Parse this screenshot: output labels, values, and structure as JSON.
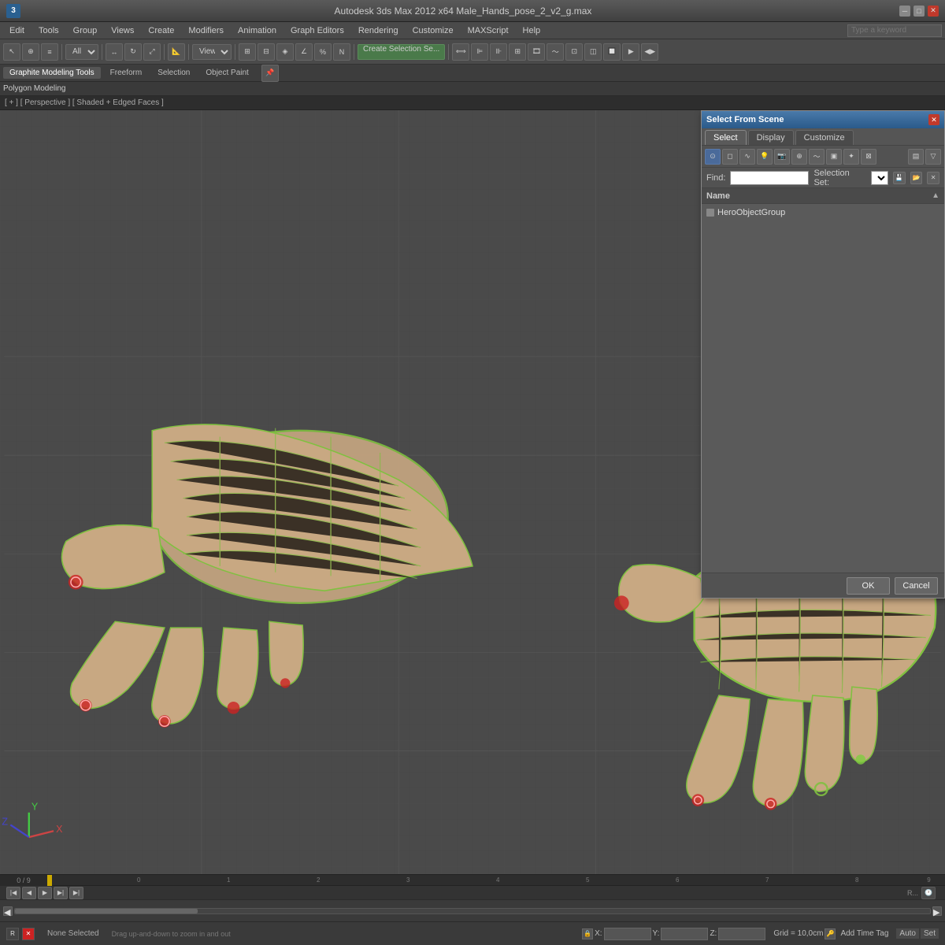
{
  "titlebar": {
    "app_icon": "3",
    "title": "Autodesk 3ds Max 2012 x64    Male_Hands_pose_2_v2_g.max",
    "search_placeholder": "Type a keyword",
    "minimize": "─",
    "maximize": "□",
    "close": "✕"
  },
  "menubar": {
    "items": [
      "Edit",
      "Tools",
      "Group",
      "Views",
      "Create",
      "Modifiers",
      "Animation",
      "Graph Editors",
      "Rendering",
      "Customize",
      "MAXScript",
      "Help"
    ]
  },
  "graphite_toolbar": {
    "tabs": [
      "Graphite Modeling Tools",
      "Freeform",
      "Selection",
      "Object Paint"
    ]
  },
  "polygon_bar": {
    "label": "Polygon Modeling"
  },
  "viewport_label": {
    "text": "[ + ] [ Perspective ] [ Shaded + Edged Faces ]"
  },
  "select_dialog": {
    "title": "Select From Scene",
    "close": "✕",
    "tabs": [
      "Select",
      "Display",
      "Customize"
    ],
    "active_tab": "Select",
    "find_label": "Find:",
    "find_value": "",
    "selection_set_label": "Selection Set:",
    "selection_set_value": "",
    "list_header": "Name",
    "items": [
      {
        "icon": "object-icon",
        "name": "HeroObjectGroup"
      }
    ],
    "ok_label": "OK",
    "cancel_label": "Cancel"
  },
  "timeline": {
    "frame_start": "0",
    "frame_end": "9",
    "markers": [
      "0",
      "1",
      "2",
      "3",
      "4",
      "5",
      "6",
      "7",
      "8",
      "9"
    ]
  },
  "status_bar": {
    "status_text": "None Selected",
    "hint_text": "Drag up-and-down to zoom in and out",
    "x_label": "X:",
    "y_label": "Y:",
    "z_label": "Z:",
    "grid_label": "Grid = 10,0cm",
    "time_label": "Add Time Tag",
    "auto_label": "Auto"
  },
  "toolbar": {
    "selection_type": "All",
    "view_label": "View",
    "create_selection": "Create Selection Se..."
  }
}
